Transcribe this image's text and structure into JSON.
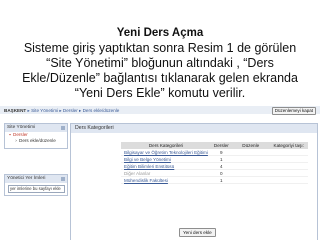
{
  "slide": {
    "title": "Yeni Ders Açma",
    "caption_lines": [
      "Sisteme giriş yaptıktan sonra Resim 1 de görülen",
      "“Site Yönetimi” bloğunun altındaki , “Ders",
      "Ekle/Düzenle” bağlantısı tıklanarak gelen ekranda",
      "“Yeni Ders Ekle” komutu verilir."
    ]
  },
  "screenshot": {
    "breadcrumb": {
      "home": "BAŞKENT",
      "rest": " ▸ Site Yönetimi ▸ Dersler ▸ Ders ekle/düzenle"
    },
    "edit_button": "Düzenlemeyi kapat",
    "site_admin_block": {
      "title": "Site Yönetimi",
      "items": [
        {
          "label": "Dersler",
          "icon": "folder-icon"
        },
        {
          "label": "Ders ekle/düzenle",
          "icon": "bullet-icon"
        }
      ]
    },
    "switch_role_block": {
      "title": "Yönetici Yer İmleri",
      "select_value": "yer imlerine bu sayfayı ekle"
    },
    "categories_panel": {
      "title": "Ders Kategorileri",
      "columns": [
        "Ders Kategorileri",
        "Dersler",
        "Düzenle",
        "Kategoriyi taşı:"
      ],
      "rows": [
        {
          "name": "Bilgisayar ve Öğretim Teknolojileri Eğitimi",
          "count": "9",
          "dim": false
        },
        {
          "name": "Bilgi ve Belge Yönetimi",
          "count": "1",
          "dim": false
        },
        {
          "name": "Eğitim Bilimleri Enstitüsü",
          "count": "4",
          "dim": false
        },
        {
          "name": "Diğer Alanlar",
          "count": "0",
          "dim": true
        },
        {
          "name": "Mühendislik Fakültesi",
          "count": "1",
          "dim": false
        }
      ],
      "add_button": "Yeni ders ekle"
    }
  }
}
